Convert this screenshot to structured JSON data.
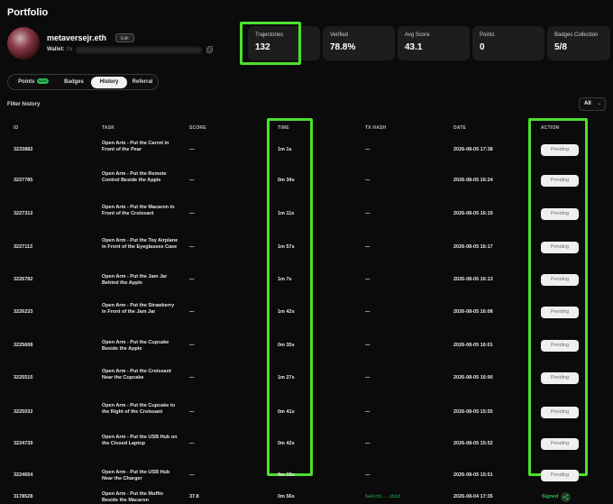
{
  "page": {
    "title": "Portfolio"
  },
  "profile": {
    "username": "metaversejr.eth",
    "edit_label": "Edit",
    "wallet_label": "Wallet:",
    "wallet_value": "0x"
  },
  "stats": [
    {
      "label": "Trajectories",
      "value": "132"
    },
    {
      "label": "Verified",
      "value": "78.8%"
    },
    {
      "label": "Avg Score",
      "value": "43.1"
    },
    {
      "label": "Points",
      "value": "0"
    },
    {
      "label": "Badges Collection",
      "value": "5/8"
    }
  ],
  "tabs": [
    {
      "label": "Points",
      "badge": "NEW"
    },
    {
      "label": "Badges"
    },
    {
      "label": "History",
      "active": true
    },
    {
      "label": "Referral"
    }
  ],
  "filter": {
    "label": "Filter history",
    "selected": "All"
  },
  "table": {
    "headers": [
      "ID",
      "TASK",
      "SCORE",
      "TIME",
      "TX HASH",
      "DATE",
      "ACTION"
    ],
    "rows": [
      {
        "id": "3233882",
        "task": "Open Arm - Put the Carrot in Front of the Pear",
        "score": "—",
        "time": "1m 1s",
        "tx": "—",
        "date": "2026-08-05 17:38",
        "action": "Pending"
      },
      {
        "id": "3227785",
        "task": "Open Arm - Put the Remote Control Beside the Apple",
        "score": "—",
        "time": "0m 34s",
        "tx": "—",
        "date": "2026-08-05 16:24",
        "action": "Pending"
      },
      {
        "id": "3227312",
        "task": "Open Arm - Put the Macaron in Front of the Croissant",
        "score": "—",
        "time": "1m 11s",
        "tx": "—",
        "date": "2026-08-05 16:19",
        "action": "Pending"
      },
      {
        "id": "3227113",
        "task": "Open Arm - Put the Toy Airplane in Front of the Eyeglasses Case",
        "score": "—",
        "time": "1m 57s",
        "tx": "—",
        "date": "2026-08-05 16:17",
        "action": "Pending"
      },
      {
        "id": "3226782",
        "task": "Open Arm - Put the Jam Jar Behind the Apple",
        "score": "—",
        "time": "1m 7s",
        "tx": "—",
        "date": "2026-08-05 16:13",
        "action": "Pending"
      },
      {
        "id": "3226233",
        "task": "Open Arm - Put the Strawberry in Front of the Jam Jar",
        "score": "—",
        "time": "1m 42s",
        "tx": "—",
        "date": "2026-08-05 16:08",
        "action": "Pending"
      },
      {
        "id": "3225608",
        "task": "Open Arm - Put the Cupcake Beside the Apple",
        "score": "—",
        "time": "0m 35s",
        "tx": "—",
        "date": "2026-08-05 16:01",
        "action": "Pending"
      },
      {
        "id": "3225515",
        "task": "Open Arm - Put the Croissant Near the Cupcake",
        "score": "—",
        "time": "1m 27s",
        "tx": "—",
        "date": "2026-08-05 16:00",
        "action": "Pending"
      },
      {
        "id": "3225032",
        "task": "Open Arm - Put the Cupcake to the Right of the Croissant",
        "score": "—",
        "time": "0m 41s",
        "tx": "—",
        "date": "2026-08-05 15:55",
        "action": "Pending"
      },
      {
        "id": "3224739",
        "task": "Open Arm - Put the USB Hub on the Closed Laptop",
        "score": "—",
        "time": "0m 42s",
        "tx": "—",
        "date": "2026-08-05 15:52",
        "action": "Pending"
      },
      {
        "id": "3224654",
        "task": "Open Arm - Put the USB Hub Near the Charger",
        "score": "—",
        "time": "0m 15s",
        "tx": "—",
        "date": "2026-08-05 15:51",
        "action": "Pending"
      },
      {
        "id": "3178528",
        "task": "Open Arm - Put the Muffin Beside the Macaron",
        "score": "37.8",
        "time": "0m 56s",
        "tx": "5e81cb...1b1d",
        "date": "2026-08-04 17:35",
        "action": "Signed"
      }
    ]
  },
  "colors": {
    "highlight": "#4be02e",
    "signed": "#2fbd57",
    "background": "#0b0b0b"
  }
}
